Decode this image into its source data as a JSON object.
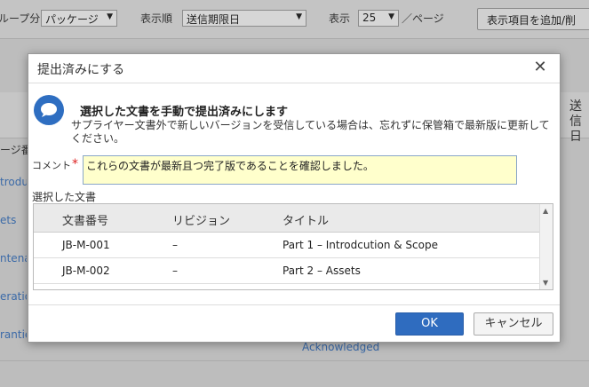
{
  "background": {
    "toolbar": {
      "group_label": "グループ分け",
      "group_value": "パッケージ",
      "sort_label": "表示順",
      "sort_value": "送信期限日",
      "display_label": "表示",
      "display_value": "25",
      "per_page": "／ページ",
      "add_columns_button": "表示項目を追加/削"
    },
    "column_right": "送信日",
    "column_left": "ージ番号",
    "row_links": [
      "troduc",
      "ets",
      "ntena",
      "eratio",
      "rantie"
    ],
    "acknowledged": "Acknowledged"
  },
  "dialog": {
    "title": "提出済みにする",
    "message_heading": "選択した文書を手動で提出済みにします",
    "message_body": "サプライヤー文書外で新しいバージョンを受信している場合は、忘れずに保管箱で最新版に更新してください。",
    "comment_label": "コメント",
    "required_mark": "*",
    "comment_value": "これらの文書が最新且つ完了版であることを確認しました。",
    "selected_docs_label": "選択した文書",
    "columns": [
      "文書番号",
      "リビジョン",
      "タイトル"
    ],
    "rows": [
      {
        "doc_no": "JB-M-001",
        "revision": "–",
        "title": "Part 1 – Introdcution & Scope"
      },
      {
        "doc_no": "JB-M-002",
        "revision": "–",
        "title": "Part 2 – Assets"
      }
    ],
    "ok_button": "OK",
    "cancel_button": "キャンセル"
  },
  "colors": {
    "primary": "#2f6cbf",
    "comment_bg": "#ffffcc",
    "required": "#dd2222"
  },
  "icons": {
    "close": "close-icon",
    "info": "chat-bubble-icon"
  }
}
